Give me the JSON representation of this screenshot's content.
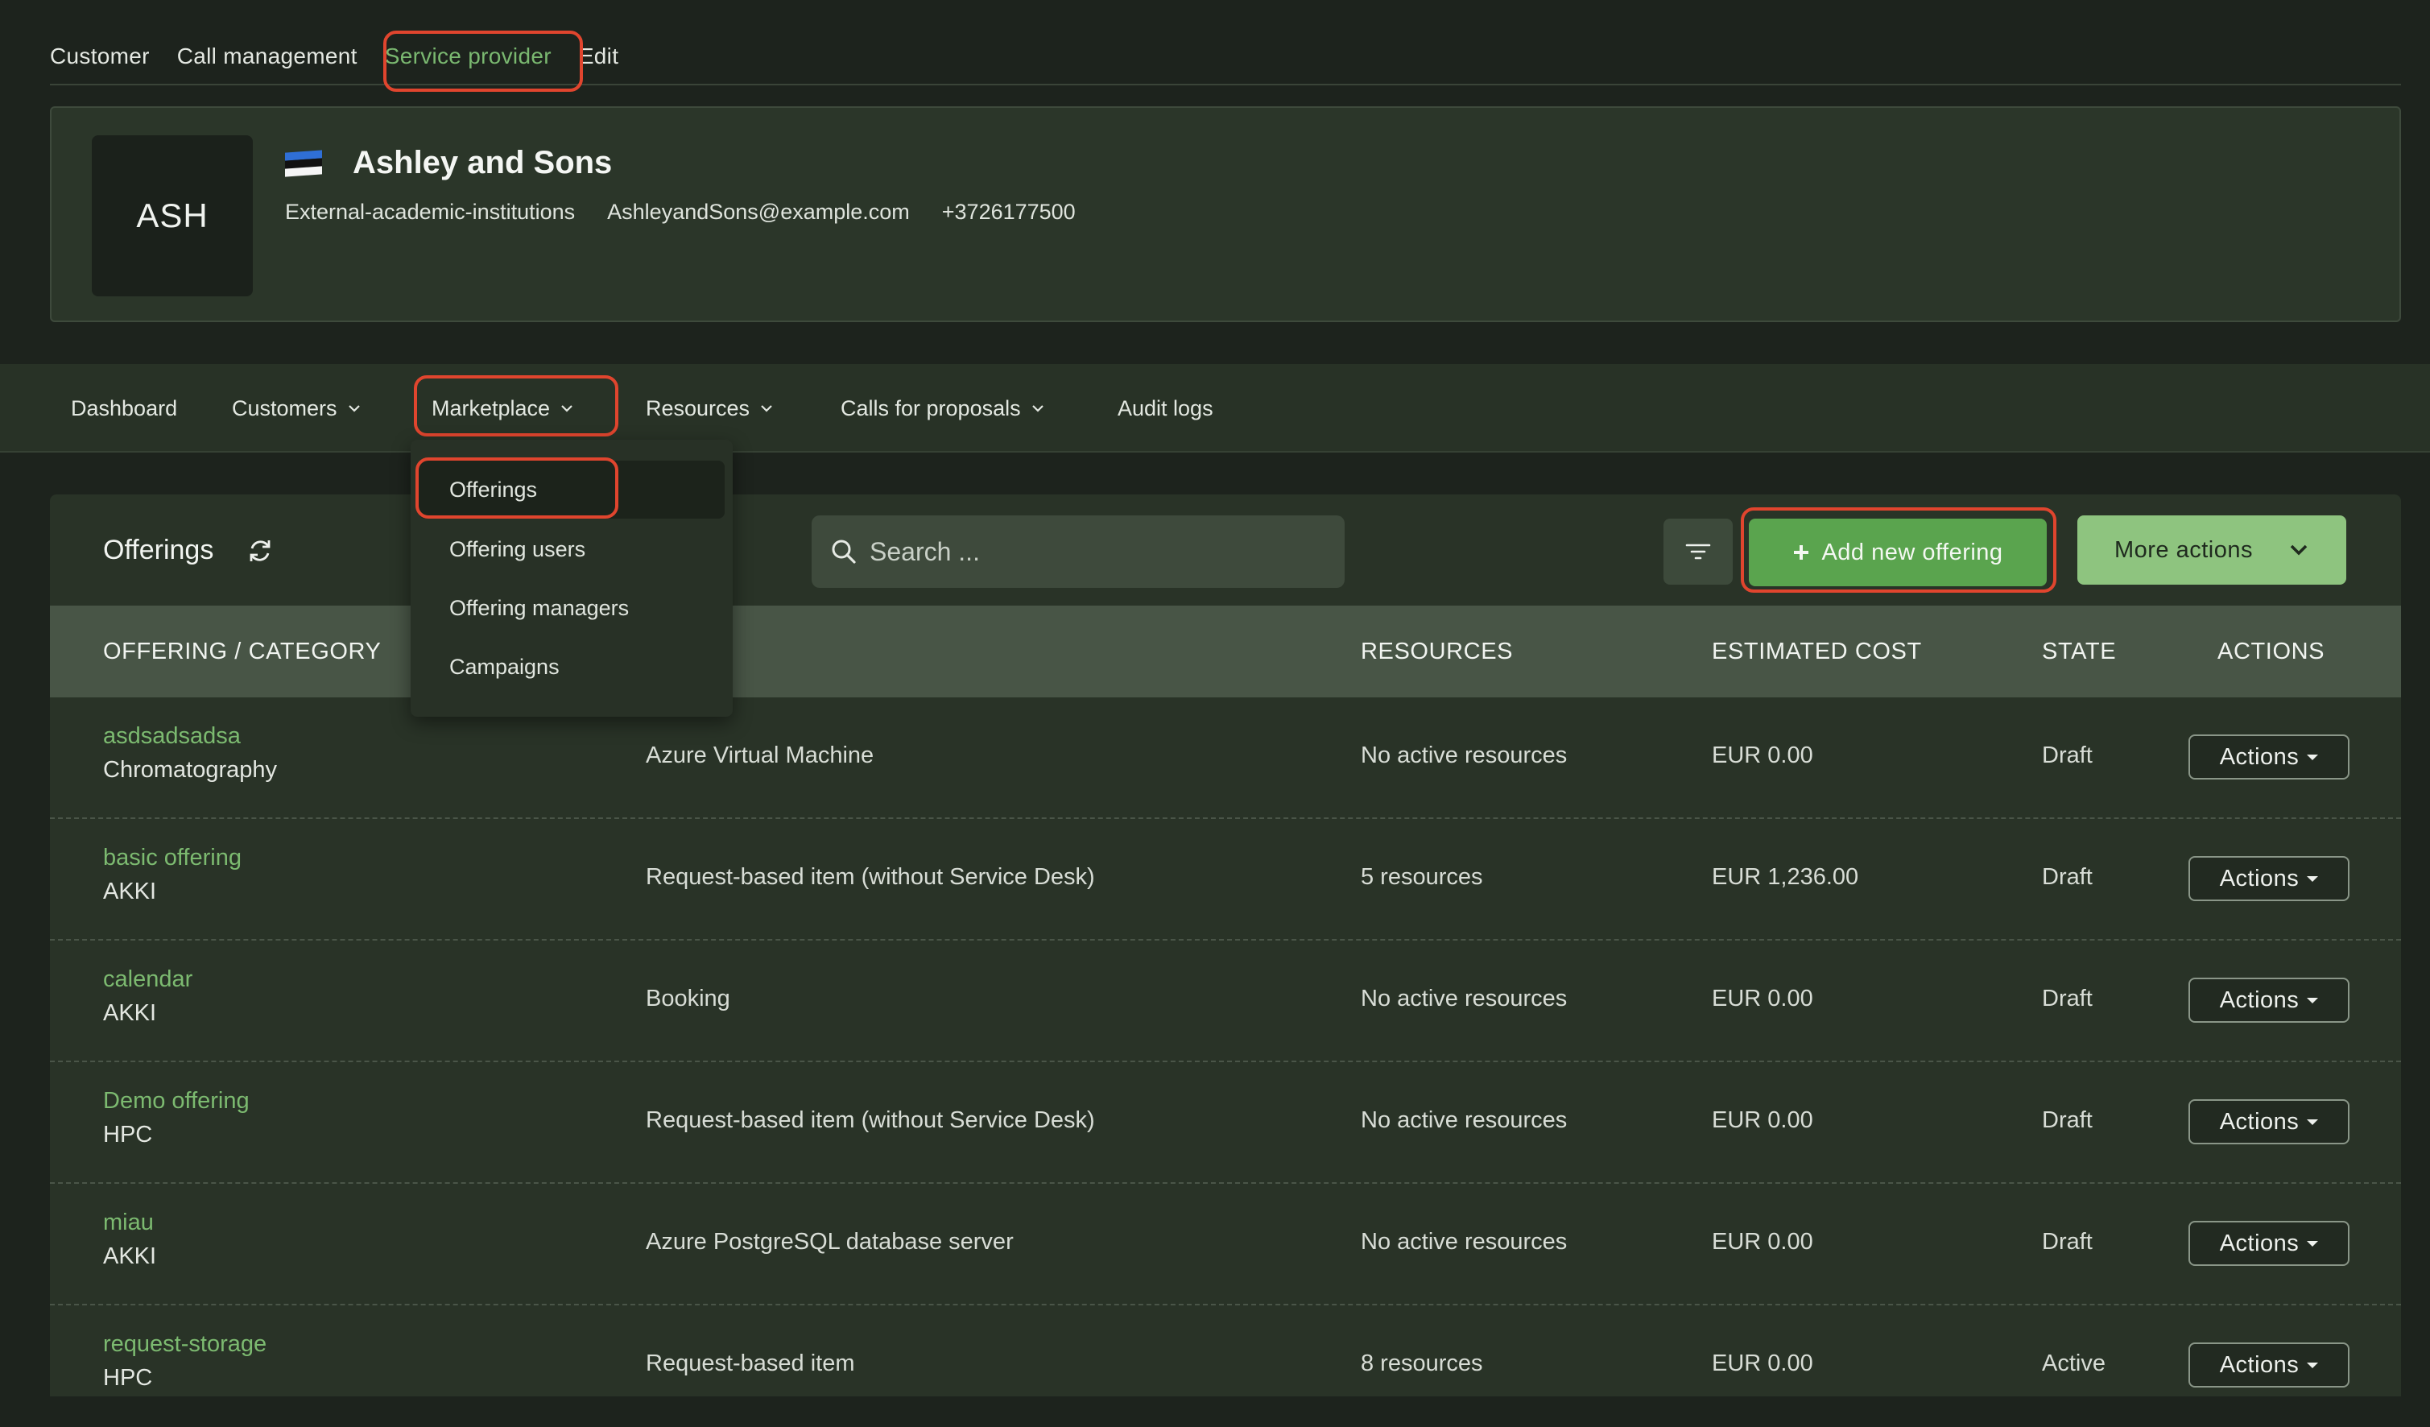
{
  "top_tabs": [
    {
      "label": "Customer"
    },
    {
      "label": "Call management"
    },
    {
      "label": "Service provider",
      "active": true
    },
    {
      "label": "Edit"
    }
  ],
  "profile": {
    "avatar_text": "ASH",
    "flag_icon": "estonia-flag-icon",
    "flag_colors": [
      "#2f6fd6",
      "#111111",
      "#f5f5f5"
    ],
    "name": "Ashley and Sons",
    "type": "External-academic-institutions",
    "email": "AshleyandSons@example.com",
    "phone": "+3726177500"
  },
  "main_nav": {
    "dashboard": "Dashboard",
    "customers": "Customers",
    "marketplace": "Marketplace",
    "resources": "Resources",
    "calls": "Calls for proposals",
    "audit": "Audit logs"
  },
  "marketplace_menu": {
    "offerings": "Offerings",
    "offering_users": "Offering users",
    "offering_managers": "Offering managers",
    "campaigns": "Campaigns"
  },
  "panel": {
    "title": "Offerings",
    "search_placeholder": "Search ...",
    "add_label": "Add new offering",
    "more_label": "More actions"
  },
  "table": {
    "headers": {
      "offering": "OFFERING / CATEGORY",
      "resources": "RESOURCES",
      "cost": "ESTIMATED COST",
      "state": "STATE",
      "actions": "ACTIONS"
    },
    "action_label": "Actions",
    "rows": [
      {
        "name": "asdsadsadsa",
        "category": "Chromatography",
        "type": "Azure Virtual Machine",
        "resources": "No active resources",
        "cost": "EUR 0.00",
        "state": "Draft"
      },
      {
        "name": "basic offering",
        "category": "AKKI",
        "type": "Request-based item (without Service Desk)",
        "resources": "5 resources",
        "cost": "EUR 1,236.00",
        "state": "Draft"
      },
      {
        "name": "calendar",
        "category": "AKKI",
        "type": "Booking",
        "resources": "No active resources",
        "cost": "EUR 0.00",
        "state": "Draft"
      },
      {
        "name": "Demo offering",
        "category": "HPC",
        "type": "Request-based item (without Service Desk)",
        "resources": "No active resources",
        "cost": "EUR 0.00",
        "state": "Draft"
      },
      {
        "name": "miau",
        "category": "AKKI",
        "type": "Azure PostgreSQL database server",
        "resources": "No active resources",
        "cost": "EUR 0.00",
        "state": "Draft"
      },
      {
        "name": "request-storage",
        "category": "HPC",
        "type": "Request-based item",
        "resources": "8 resources",
        "cost": "EUR 0.00",
        "state": "Active"
      }
    ]
  },
  "colors": {
    "accent_green": "#7ab870",
    "highlight_ring": "#e0452e",
    "primary_button": "#5aa44e",
    "secondary_button": "#8ec47f"
  }
}
